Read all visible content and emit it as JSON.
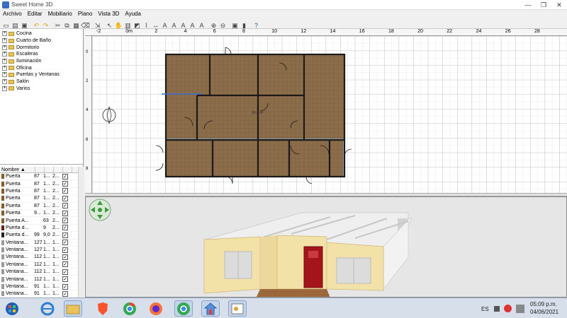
{
  "window": {
    "title": "Sweet Home 3D",
    "minimize": "—",
    "restore": "❐",
    "close": "✕"
  },
  "menu": [
    "Archivo",
    "Editar",
    "Mobiliario",
    "Plano",
    "Vista 3D",
    "Ayuda"
  ],
  "toolbar_icons": [
    "new-icon",
    "open-icon",
    "save-icon",
    "cut-icon",
    "copy-icon",
    "paste-icon",
    "undo-icon",
    "redo-icon",
    "delete-icon",
    "add-furniture-icon",
    "select-icon",
    "pan-icon",
    "create-walls-icon",
    "create-rooms-icon",
    "create-polylines-icon",
    "create-dimensions-icon",
    "create-labels-icon",
    "text-style-icon",
    "zoom-in-icon",
    "zoom-out-icon",
    "photo-icon",
    "video-icon",
    "help-icon"
  ],
  "catalog": [
    {
      "name": "Cocina",
      "expand": "+"
    },
    {
      "name": "Cuarto de Baño",
      "expand": "+"
    },
    {
      "name": "Dormitorio",
      "expand": "+"
    },
    {
      "name": "Escaleras",
      "expand": "+"
    },
    {
      "name": "Iluminación",
      "expand": "+"
    },
    {
      "name": "Oficina",
      "expand": "+"
    },
    {
      "name": "Puertas y Ventanas",
      "expand": "+"
    },
    {
      "name": "Salón",
      "expand": "+"
    },
    {
      "name": "Varios",
      "expand": "+"
    }
  ],
  "furniture_table": {
    "header_name": "Nombre ▲",
    "rows": [
      {
        "name": "Puerta",
        "c2": "87",
        "c3": "1...",
        "c4": "2...",
        "color": "#8b5a2b"
      },
      {
        "name": "Puerta",
        "c2": "87",
        "c3": "1...",
        "c4": "2...",
        "color": "#8b5a2b"
      },
      {
        "name": "Puerta",
        "c2": "87",
        "c3": "1...",
        "c4": "2...",
        "color": "#8b5a2b"
      },
      {
        "name": "Puerta",
        "c2": "87",
        "c3": "1...",
        "c4": "2...",
        "color": "#8b5a2b"
      },
      {
        "name": "Puerta",
        "c2": "87",
        "c3": "1...",
        "c4": "2...",
        "color": "#8b5a2b"
      },
      {
        "name": "Puerta",
        "c2": "9...",
        "c3": "1...",
        "c4": "2...",
        "color": "#8b5a2b"
      },
      {
        "name": "Puerta A...",
        "c2": "",
        "c3": "63",
        "c4": "2...",
        "color": "#8b5a2b"
      },
      {
        "name": "Puerta d...",
        "c2": "",
        "c3": "9",
        "c4": "2...",
        "color": "#6b2020"
      },
      {
        "name": "Puerta d...",
        "c2": "99",
        "c3": "9,0",
        "c4": "2...",
        "color": "#222222"
      },
      {
        "name": "Ventana...",
        "c2": "127",
        "c3": "1...",
        "c4": "1...",
        "color": "#9a9a9a"
      },
      {
        "name": "Ventana...",
        "c2": "127",
        "c3": "1...",
        "c4": "1...",
        "color": "#9a9a9a"
      },
      {
        "name": "Ventana...",
        "c2": "112",
        "c3": "1...",
        "c4": "1...",
        "color": "#9a9a9a"
      },
      {
        "name": "Ventana...",
        "c2": "112",
        "c3": "1...",
        "c4": "1...",
        "color": "#9a9a9a"
      },
      {
        "name": "Ventana...",
        "c2": "112",
        "c3": "1...",
        "c4": "1...",
        "color": "#9a9a9a"
      },
      {
        "name": "Ventana...",
        "c2": "112",
        "c3": "1...",
        "c4": "1...",
        "color": "#9a9a9a"
      },
      {
        "name": "Ventana...",
        "c2": "91",
        "c3": "1...",
        "c4": "1...",
        "color": "#9a9a9a"
      },
      {
        "name": "Ventana...",
        "c2": "91",
        "c3": "1...",
        "c4": "1...",
        "color": "#9a9a9a"
      }
    ],
    "check": "✓"
  },
  "ruler": {
    "top": [
      "-2",
      "0m",
      "2",
      "4",
      "6",
      "8",
      "10",
      "12",
      "14",
      "16",
      "18",
      "20",
      "22",
      "24",
      "26",
      "28"
    ],
    "left": [
      "0",
      "2",
      "4",
      "6",
      "8"
    ]
  },
  "plan": {
    "room_label": "99,6 m²",
    "floor_color": "#8c6d4a",
    "wall_color": "#1a1a1a"
  },
  "view3d": {
    "wall_color": "#f3e2a8",
    "door_color": "#a3141b",
    "roof_color": "#e6e6e6",
    "deck_color": "#a06a3c"
  },
  "taskbar": {
    "lang": "ES",
    "time": "05:09 p.m.",
    "date": "04/06/2021"
  }
}
